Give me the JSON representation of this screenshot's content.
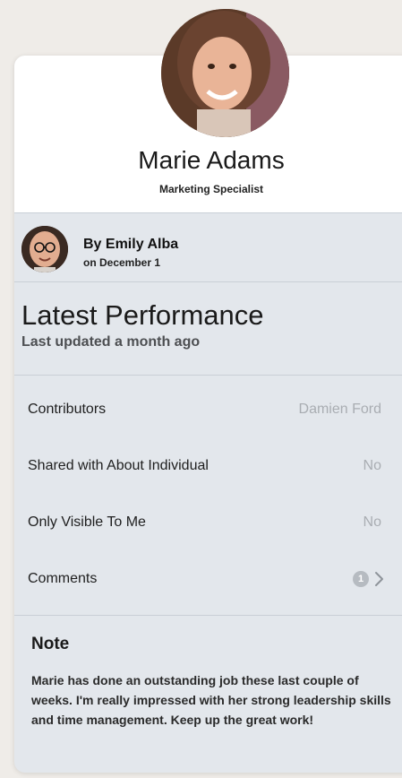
{
  "profile": {
    "name": "Marie Adams",
    "role": "Marketing Specialist"
  },
  "author": {
    "name": "By Emily Alba",
    "date": "on December 1"
  },
  "performance": {
    "title": "Latest Performance",
    "subtitle": "Last updated a month ago"
  },
  "details": [
    {
      "label": "Contributors",
      "value": "Damien Ford"
    },
    {
      "label": "Shared with About Individual",
      "value": "No"
    },
    {
      "label": "Only Visible To Me",
      "value": "No"
    },
    {
      "label": "Comments",
      "count": "1"
    }
  ],
  "note": {
    "title": "Note",
    "body": "Marie has done an outstanding job these last couple of weeks. I'm really impressed with her strong leadership skills and time management. Keep up the great work!"
  },
  "icons": {
    "comments_chevron": "chevron-right-icon"
  }
}
